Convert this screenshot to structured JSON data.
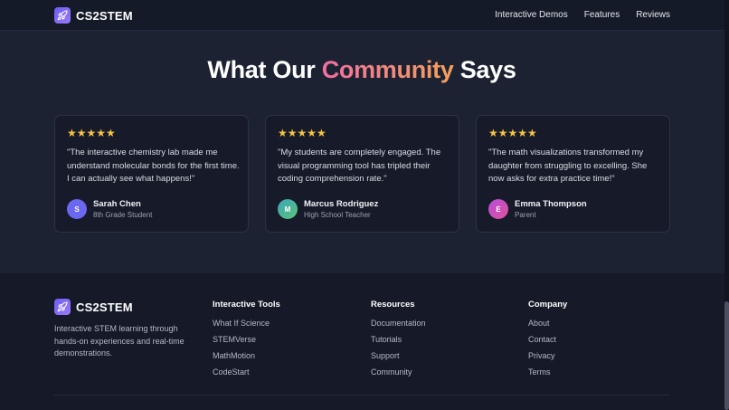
{
  "header": {
    "brand": "CS2STEM",
    "nav": [
      "Interactive Demos",
      "Features",
      "Reviews"
    ]
  },
  "testimonials": {
    "title_before": "What Our ",
    "title_highlight": "Community",
    "title_after": " Says",
    "cards": [
      {
        "stars": "★★★★★",
        "quote": "\"The interactive chemistry lab made me understand molecular bonds for the first time. I can actually see what happens!\"",
        "initial": "S",
        "name": "Sarah Chen",
        "role": "8th Grade Student"
      },
      {
        "stars": "★★★★★",
        "quote": "\"My students are completely engaged. The visual programming tool has tripled their coding comprehension rate.\"",
        "initial": "M",
        "name": "Marcus Rodriguez",
        "role": "High School Teacher"
      },
      {
        "stars": "★★★★★",
        "quote": "\"The math visualizations transformed my daughter from struggling to excelling. She now asks for extra practice time!\"",
        "initial": "E",
        "name": "Emma Thompson",
        "role": "Parent"
      }
    ]
  },
  "footer": {
    "brand": "CS2STEM",
    "description": "Interactive STEM learning through hands-on experiences and real-time demonstrations.",
    "columns": [
      {
        "title": "Interactive Tools",
        "links": [
          "What If Science",
          "STEMVerse",
          "MathMotion",
          "CodeStart"
        ]
      },
      {
        "title": "Resources",
        "links": [
          "Documentation",
          "Tutorials",
          "Support",
          "Community"
        ]
      },
      {
        "title": "Company",
        "links": [
          "About",
          "Contact",
          "Privacy",
          "Terms"
        ]
      }
    ]
  },
  "colors": {
    "accent": "#6d5cf6",
    "star": "#f5c443",
    "highlight_start": "#f06fa0",
    "highlight_end": "#f4a15a",
    "avatar_sarah": "#6a67f0",
    "avatar_marcus": "#3fae93",
    "avatar_emma": "#b44fd9"
  },
  "icons": {
    "logo": "rocket-icon",
    "rating": "star-icon"
  }
}
